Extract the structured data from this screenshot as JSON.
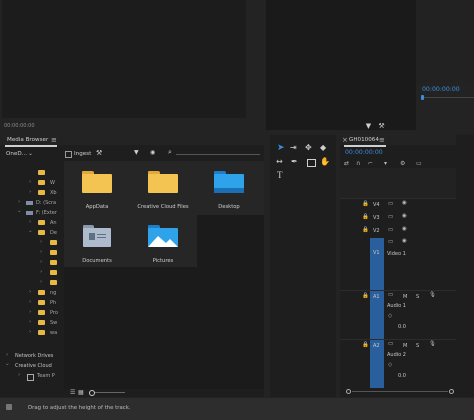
{
  "source_monitor": {
    "timecode": "00:00:00:00"
  },
  "program_monitor": {
    "timecode": "00:00:00:00"
  },
  "media_browser": {
    "tab_label": "Media Browser",
    "menu_icon": "hamburger-icon",
    "location": "OneD...",
    "ingest_label": "Ingest",
    "search_icon": "search-icon",
    "tiles": [
      {
        "label": "AppData",
        "icon": "folder-icon"
      },
      {
        "label": "Creative Cloud Files",
        "icon": "folder-icon"
      },
      {
        "label": "Desktop",
        "icon": "desktop-folder-icon"
      },
      {
        "label": "Documents",
        "icon": "documents-folder-icon"
      },
      {
        "label": "Pictures",
        "icon": "pictures-folder-icon"
      }
    ],
    "tree": [
      {
        "label": "W",
        "indent": 2
      },
      {
        "label": "Xb",
        "indent": 2
      },
      {
        "label": "D: (Scra",
        "indent": 1
      },
      {
        "label": "F: (Exter",
        "indent": 1
      },
      {
        "label": "An",
        "indent": 2
      },
      {
        "label": "De",
        "indent": 2
      },
      {
        "label": "ng",
        "indent": 2
      },
      {
        "label": "Ph",
        "indent": 2
      },
      {
        "label": "Pro",
        "indent": 2
      },
      {
        "label": "Sw",
        "indent": 2
      },
      {
        "label": "wa",
        "indent": 2
      }
    ],
    "network_drives": "Network Drives",
    "creative_cloud": "Creative Cloud",
    "team_projects": "Team P"
  },
  "timeline": {
    "close_icon": "close-icon",
    "sequence_name": "GH010064",
    "menu_icon": "hamburger-icon",
    "timecode": "00:00:00:00",
    "video_tracks": [
      {
        "name": "V4"
      },
      {
        "name": "V3"
      },
      {
        "name": "V2"
      },
      {
        "name": "V1",
        "label": "Video 1"
      }
    ],
    "audio_tracks": [
      {
        "name": "A1",
        "label": "Audio 1",
        "m": "M",
        "s": "S"
      },
      {
        "name": "A2",
        "label": "Audio 2",
        "m": "M",
        "s": "S"
      }
    ],
    "audio_value": "0.0"
  },
  "status_bar": {
    "message": "Drag to adjust the height of the track."
  }
}
